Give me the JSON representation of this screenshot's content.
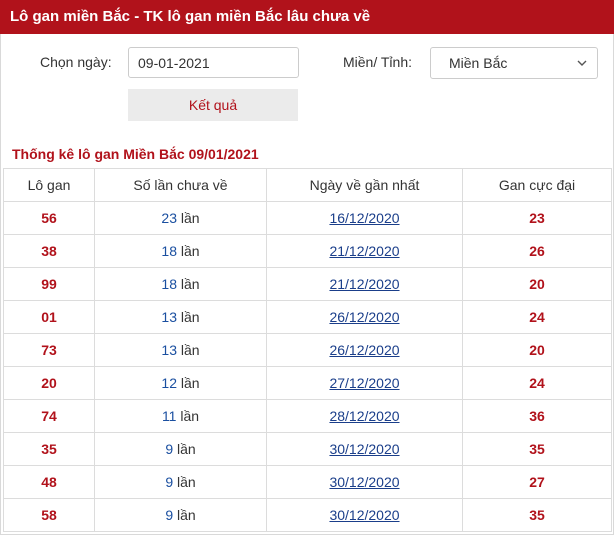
{
  "header": {
    "title": "Lô gan miền Bắc - TK lô gan miền Bắc lâu chưa về"
  },
  "form": {
    "date_label": "Chọn ngày:",
    "date_value": "09-01-2021",
    "region_label": "Miền/ Tỉnh:",
    "region_value": "Miền Bắc",
    "submit_label": "Kết quả"
  },
  "table": {
    "caption": "Thống kê lô gan Miền Bắc 09/01/2021",
    "columns": [
      "Lô gan",
      "Số lần chưa về",
      "Ngày về gần nhất",
      "Gan cực đại"
    ],
    "unit": "lần",
    "rows": [
      {
        "number": "56",
        "count": "23",
        "date": "16/12/2020",
        "max_gan": "23"
      },
      {
        "number": "38",
        "count": "18",
        "date": "21/12/2020",
        "max_gan": "26"
      },
      {
        "number": "99",
        "count": "18",
        "date": "21/12/2020",
        "max_gan": "20"
      },
      {
        "number": "01",
        "count": "13",
        "date": "26/12/2020",
        "max_gan": "24"
      },
      {
        "number": "73",
        "count": "13",
        "date": "26/12/2020",
        "max_gan": "20"
      },
      {
        "number": "20",
        "count": "12",
        "date": "27/12/2020",
        "max_gan": "24"
      },
      {
        "number": "74",
        "count": "11",
        "date": "28/12/2020",
        "max_gan": "36"
      },
      {
        "number": "35",
        "count": "9",
        "date": "30/12/2020",
        "max_gan": "35"
      },
      {
        "number": "48",
        "count": "9",
        "date": "30/12/2020",
        "max_gan": "27"
      },
      {
        "number": "58",
        "count": "9",
        "date": "30/12/2020",
        "max_gan": "35"
      }
    ]
  },
  "colors": {
    "brand": "#b1121b",
    "link": "#1a3e8a",
    "count": "#1a4fa0"
  },
  "icons": {
    "select_arrow": "chevron-down-icon"
  }
}
